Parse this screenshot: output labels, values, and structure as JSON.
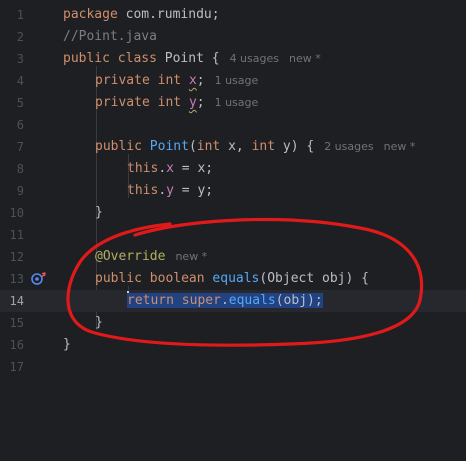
{
  "editor": {
    "line_numbers": [
      "1",
      "2",
      "3",
      "4",
      "5",
      "6",
      "7",
      "8",
      "9",
      "10",
      "11",
      "12",
      "13",
      "14",
      "15",
      "16",
      "17"
    ],
    "current_line": "14",
    "tokens": {
      "package_kw": "package",
      "package_name": " com.rumindu;",
      "comment": "//Point.java",
      "public": "public",
      "class": "class",
      "class_name": "Point",
      "brace_open": " {",
      "private": "private",
      "int": "int",
      "field_x": "x",
      "field_y": "y",
      "semicolon": ";",
      "ctor_name": "Point",
      "ctor_params_1": "(",
      "ctor_params_2": " x, ",
      "ctor_params_3": " y) {",
      "this": "this",
      "dot_x": ".",
      "assign_x": " = x;",
      "assign_y": " = y;",
      "close_brace": "}",
      "annotation": "@Override",
      "boolean": "boolean",
      "equals": "equals",
      "equals_params": "(Object obj) {",
      "return": "return",
      "super": "super",
      "dot": ".",
      "equals_call_args": "(obj);"
    },
    "hints": {
      "class_usages": "4 usages",
      "new_star": "new *",
      "one_usage": "1 usage",
      "ctor_usages": "2 usages"
    },
    "gutter_icons": [
      "override-method-icon"
    ],
    "colors": {
      "keyword": "#cf8e6d",
      "method": "#56a8f5",
      "field": "#c77dbb",
      "annotation": "#b3ae60",
      "comment": "#7a7e85",
      "selection": "#214283",
      "circle_annotation": "#e01a1a"
    }
  }
}
